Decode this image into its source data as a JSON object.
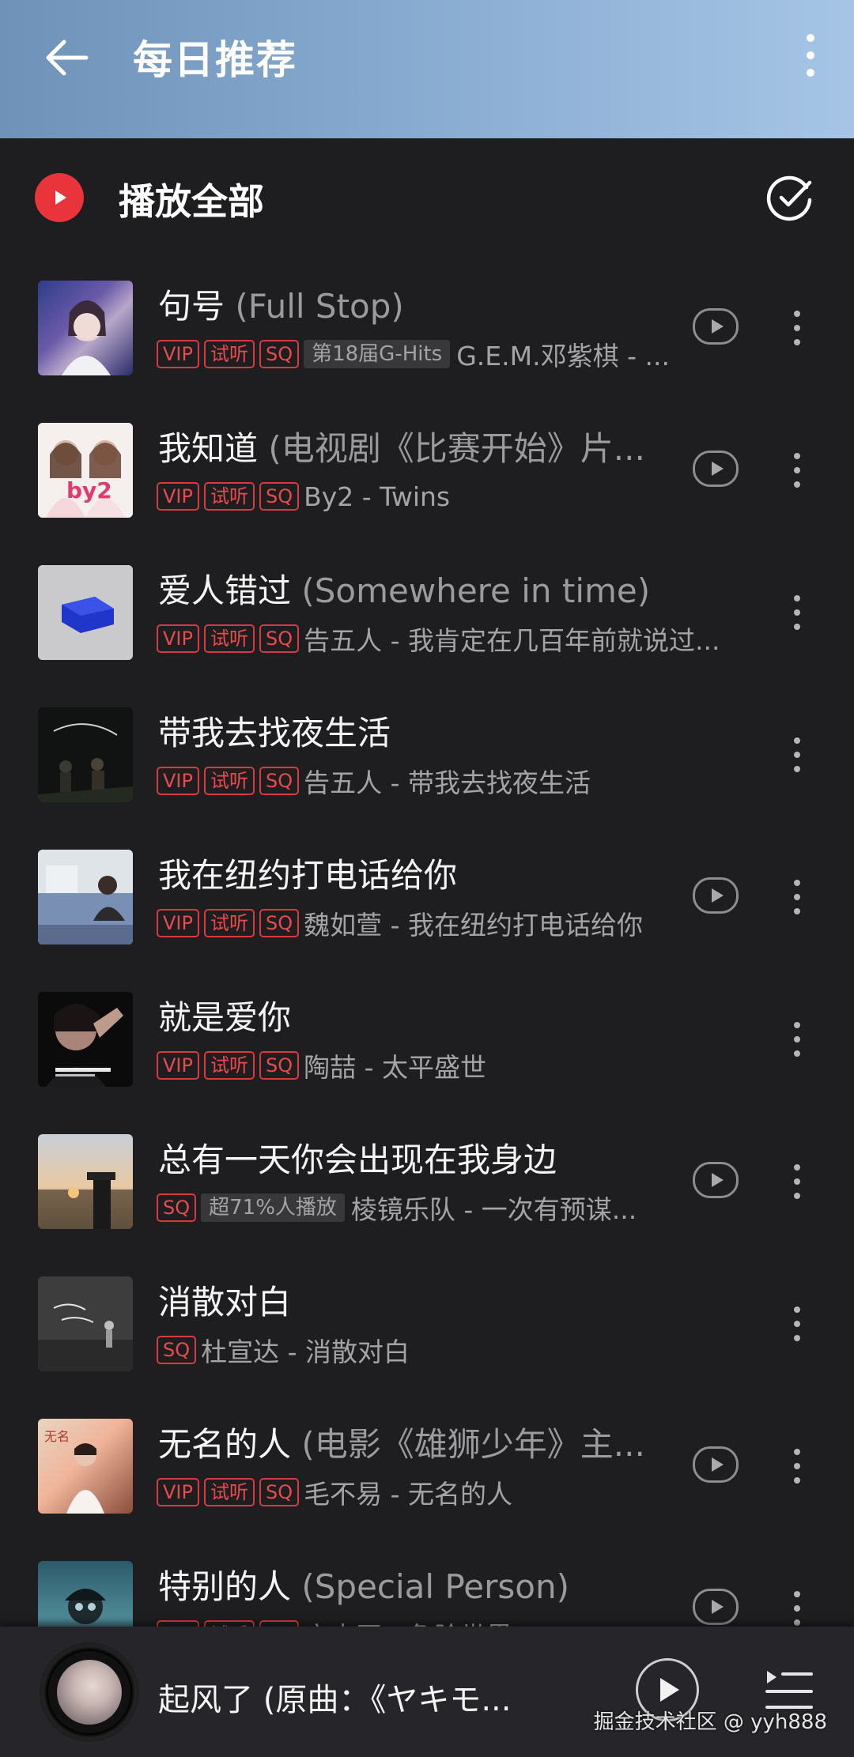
{
  "header": {
    "title": "每日推荐",
    "back_icon": "arrow-left-icon",
    "more_icon": "more-vertical-icon"
  },
  "play_all": {
    "label": "播放全部",
    "icon": "play-circle-icon",
    "multiselect_icon": "check-circle-icon",
    "accent_color": "#e9343b"
  },
  "songs": [
    {
      "title": "句号",
      "subtitle": "(Full Stop)",
      "tags": [
        "VIP",
        "试听",
        "SQ"
      ],
      "badge": "第18届G-Hits",
      "artist": "G.E.M.邓紫棋 - ...",
      "has_mv": true
    },
    {
      "title": "我知道",
      "subtitle": "(电视剧《比赛开始》片...",
      "tags": [
        "VIP",
        "试听",
        "SQ"
      ],
      "badge": "",
      "artist": "By2 - Twins",
      "has_mv": true
    },
    {
      "title": "爱人错过",
      "subtitle": "(Somewhere in time)",
      "tags": [
        "VIP",
        "试听",
        "SQ"
      ],
      "badge": "",
      "artist": "告五人 - 我肯定在几百年前就说过...",
      "has_mv": false
    },
    {
      "title": "带我去找夜生活",
      "subtitle": "",
      "tags": [
        "VIP",
        "试听",
        "SQ"
      ],
      "badge": "",
      "artist": "告五人 - 带我去找夜生活",
      "has_mv": false
    },
    {
      "title": "我在纽约打电话给你",
      "subtitle": "",
      "tags": [
        "VIP",
        "试听",
        "SQ"
      ],
      "badge": "",
      "artist": "魏如萱 - 我在纽约打电话给你",
      "has_mv": true
    },
    {
      "title": "就是爱你",
      "subtitle": "",
      "tags": [
        "VIP",
        "试听",
        "SQ"
      ],
      "badge": "",
      "artist": "陶喆 - 太平盛世",
      "has_mv": false
    },
    {
      "title": "总有一天你会出现在我身边",
      "subtitle": "",
      "tags": [
        "SQ"
      ],
      "badge": "超71%人播放",
      "artist": "棱镜乐队 - 一次有预谋...",
      "has_mv": true
    },
    {
      "title": "消散对白",
      "subtitle": "",
      "tags": [
        "SQ"
      ],
      "badge": "",
      "artist": "杜宣达 - 消散对白",
      "has_mv": false
    },
    {
      "title": "无名的人",
      "subtitle": "(电影《雄狮少年》主...",
      "tags": [
        "VIP",
        "试听",
        "SQ"
      ],
      "badge": "",
      "artist": "毛不易 - 无名的人",
      "has_mv": true
    },
    {
      "title": "特别的人",
      "subtitle": "(Special Person)",
      "tags": [
        "VIP",
        "试听",
        "SQ"
      ],
      "badge": "",
      "artist": "方大同 - 危险世界",
      "has_mv": true
    }
  ],
  "player": {
    "now_playing": "起风了 (原曲：《ヤキモ...",
    "play_icon": "play-icon",
    "playlist_icon": "playlist-icon"
  },
  "watermark": "掘金技术社区 @ yyh888"
}
